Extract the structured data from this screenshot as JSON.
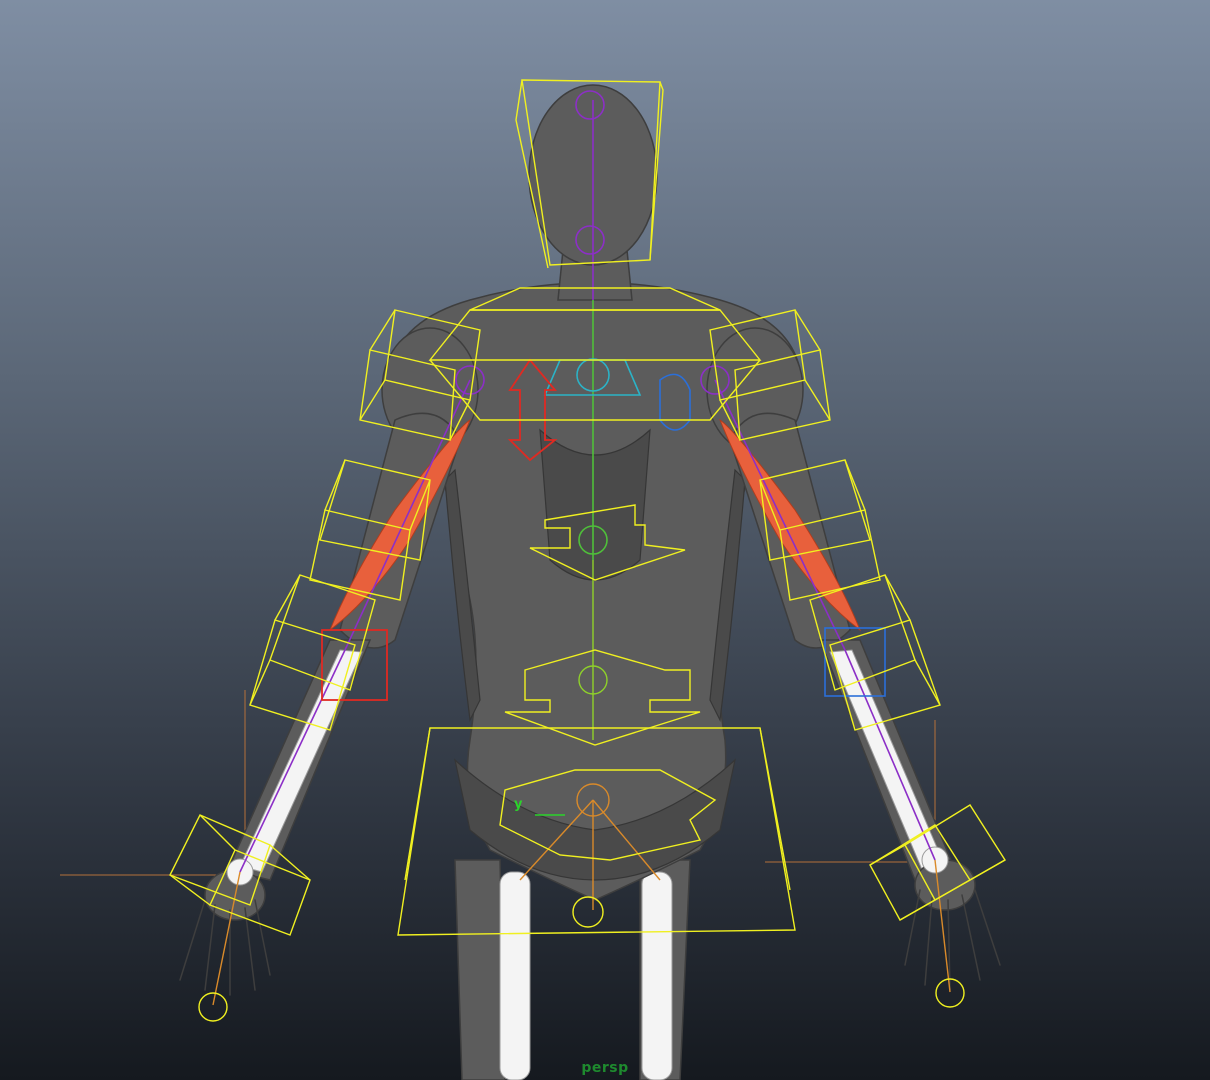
{
  "viewport": {
    "camera_label": "persp",
    "axis_label": "y"
  },
  "colors": {
    "control_curve": "#f0f020",
    "joint_chain": "#8c2fc7",
    "muscle": "#e8603c",
    "mesh": "#5c5c5c",
    "bone": "#f4f4f4",
    "left_control": "#e02a22",
    "right_control": "#2b6fd9"
  }
}
